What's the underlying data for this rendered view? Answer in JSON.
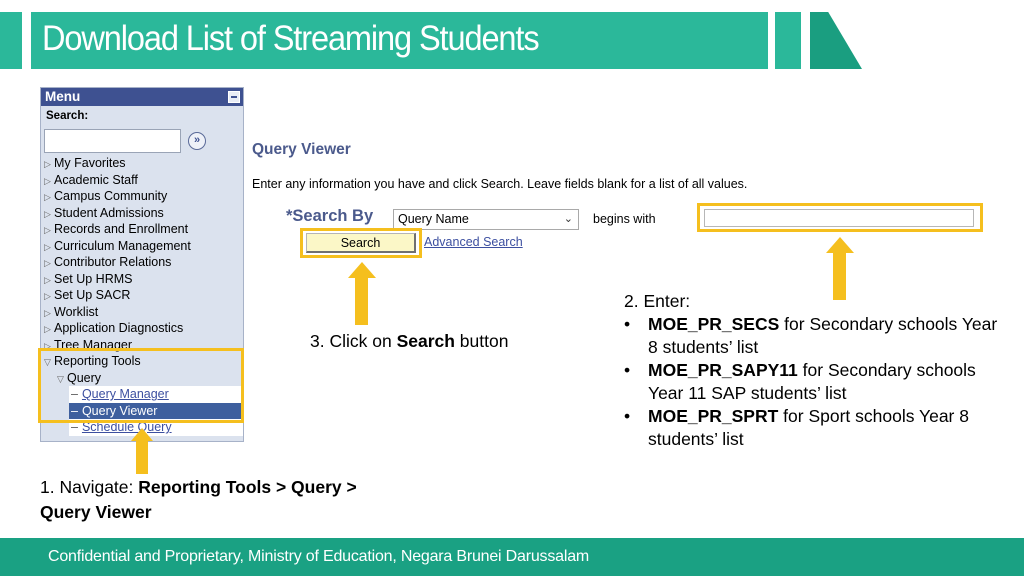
{
  "slide": {
    "title": "Download List of Streaming Students",
    "footer": "Confidential and Proprietary, Ministry of Education, Negara Brunei Darussalam",
    "accent_color": "#2bb89a",
    "highlight_color": "#f5bf1e"
  },
  "menu": {
    "header": "Menu",
    "search_label": "Search:",
    "search_value": "",
    "go_icon": "»",
    "items": [
      {
        "label": "My Favorites",
        "icon": "triangle-right-icon"
      },
      {
        "label": "Academic Staff",
        "icon": "triangle-right-icon"
      },
      {
        "label": "Campus Community",
        "icon": "triangle-right-icon"
      },
      {
        "label": "Student Admissions",
        "icon": "triangle-right-icon"
      },
      {
        "label": "Records and Enrollment",
        "icon": "triangle-right-icon"
      },
      {
        "label": "Curriculum Management",
        "icon": "triangle-right-icon"
      },
      {
        "label": "Contributor Relations",
        "icon": "triangle-right-icon"
      },
      {
        "label": "Set Up HRMS",
        "icon": "triangle-right-icon"
      },
      {
        "label": "Set Up SACR",
        "icon": "triangle-right-icon"
      },
      {
        "label": "Worklist",
        "icon": "triangle-right-icon"
      },
      {
        "label": "Application Diagnostics",
        "icon": "triangle-right-icon"
      },
      {
        "label": "Tree Manager",
        "icon": "triangle-right-icon"
      },
      {
        "label": "Reporting Tools",
        "icon": "triangle-down-icon"
      }
    ],
    "sub_item": {
      "label": "Query",
      "icon": "triangle-down-icon"
    },
    "leaf_items": [
      {
        "label": "Query Manager",
        "active": false
      },
      {
        "label": "Query Viewer",
        "active": true
      },
      {
        "label": "Schedule Query",
        "active": false
      }
    ]
  },
  "query_viewer": {
    "title": "Query Viewer",
    "instructions": "Enter any information you have and click Search. Leave fields blank for a list of all values.",
    "search_by_label": "*Search By",
    "search_by_value": "Query Name",
    "operator": "begins with",
    "search_value": "",
    "search_button": "Search",
    "advanced_search_link": "Advanced Search"
  },
  "annotations": {
    "step1_prefix": "1. Navigate: ",
    "step1_bold": "Reporting Tools > Query > Query Viewer",
    "step2_heading": "2. Enter:",
    "step2_items": [
      {
        "code": "MOE_PR_SECS",
        "desc": " for Secondary schools Year 8 students’ list"
      },
      {
        "code": "MOE_PR_SAPY11",
        "desc": " for Secondary schools Year 11 SAP students’ list"
      },
      {
        "code": "MOE_PR_SPRT",
        "desc": " for Sport schools Year 8 students’ list"
      }
    ],
    "step3_prefix": "3. Click on ",
    "step3_bold": "Search",
    "step3_suffix": " button"
  }
}
